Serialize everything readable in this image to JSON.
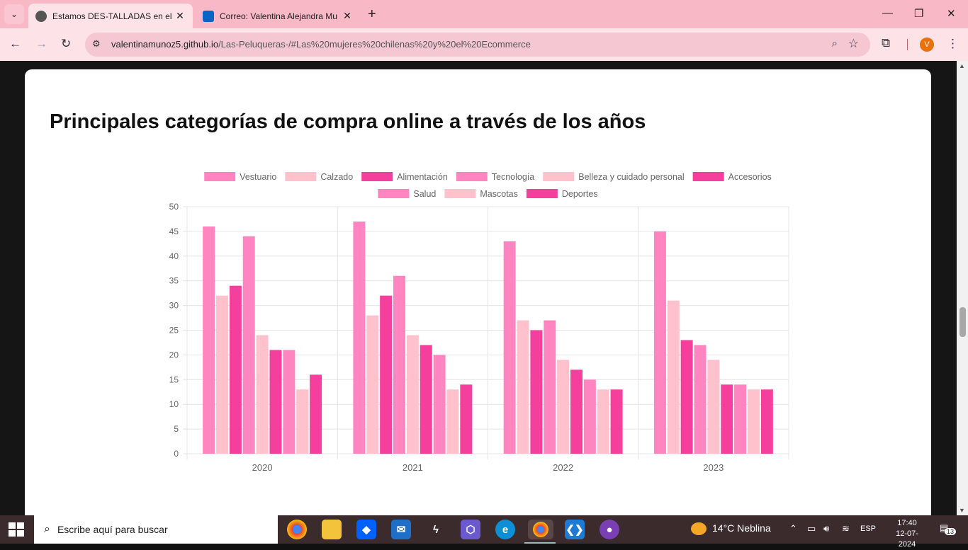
{
  "browser": {
    "tabs": [
      {
        "title": "Estamos DES-TALLADAS en el E",
        "active": true,
        "favicon": "globe-icon"
      },
      {
        "title": "Correo: Valentina Alejandra Mu",
        "active": false,
        "favicon": "outlook-icon"
      }
    ],
    "url_host": "valentinamunoz5.github.io",
    "url_path": "/Las-Peluqueras-/#Las%20mujeres%20chilenas%20y%20el%20Ecommerce",
    "profile_initial": "V"
  },
  "page": {
    "heading": "Principales categorías de compra online a través de los años"
  },
  "chart_data": {
    "type": "bar",
    "categories": [
      "2020",
      "2021",
      "2022",
      "2023"
    ],
    "series": [
      {
        "name": "Vestuario",
        "values": [
          46,
          47,
          43,
          45
        ],
        "color": "#ff85c0"
      },
      {
        "name": "Calzado",
        "values": [
          32,
          28,
          27,
          31
        ],
        "color": "#ffc2cc"
      },
      {
        "name": "Alimentación",
        "values": [
          34,
          32,
          25,
          23
        ],
        "color": "#f43f9c"
      },
      {
        "name": "Tecnología",
        "values": [
          44,
          36,
          27,
          22
        ],
        "color": "#ff85c0"
      },
      {
        "name": "Belleza y cuidado personal",
        "values": [
          24,
          24,
          19,
          19
        ],
        "color": "#ffc2cc"
      },
      {
        "name": "Accesorios",
        "values": [
          21,
          22,
          17,
          14
        ],
        "color": "#f43f9c"
      },
      {
        "name": "Salud",
        "values": [
          21,
          20,
          15,
          14
        ],
        "color": "#ff85c0"
      },
      {
        "name": "Mascotas",
        "values": [
          13,
          13,
          13,
          13
        ],
        "color": "#ffc2cc"
      },
      {
        "name": "Deportes",
        "values": [
          16,
          14,
          13,
          13
        ],
        "color": "#f43f9c"
      }
    ],
    "ylim": [
      0,
      50
    ],
    "yticks": [
      0,
      5,
      10,
      15,
      20,
      25,
      30,
      35,
      40,
      45,
      50
    ],
    "grid": true,
    "legend_position": "top"
  },
  "taskbar": {
    "search_placeholder": "Escribe aquí para buscar",
    "weather": "14°C  Neblina",
    "language": "ESP",
    "time": "17:40",
    "date": "12-07-2024",
    "notifications": "13"
  }
}
